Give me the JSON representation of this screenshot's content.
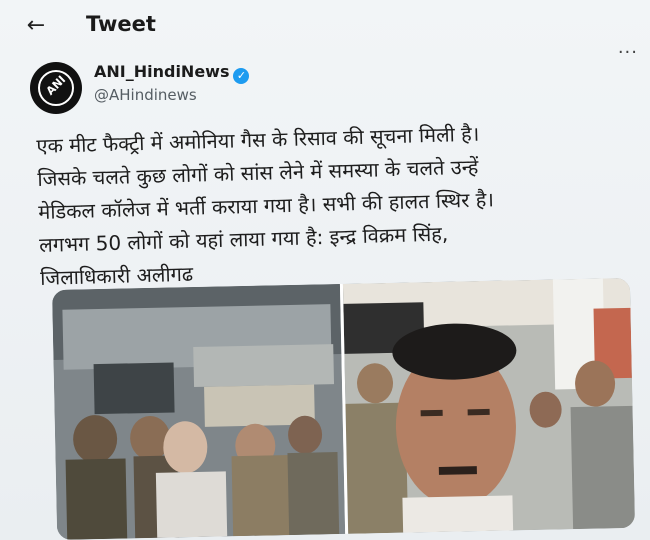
{
  "header": {
    "back_icon": "arrow-left-icon",
    "title": "Tweet"
  },
  "author": {
    "avatar_text": "ANI",
    "name": "ANI_HindiNews",
    "verified_icon": "verified-badge-icon",
    "handle": "@AHindinews",
    "more_icon": "more-options-icon"
  },
  "tweet": {
    "lines": [
      "एक मीट फैक्ट्री में अमोनिया गैस के रिसाव की सूचना मिली है।",
      "जिसके चलते कुछ लोगों को सांस लेने में समस्या के चलते उन्हें",
      "मेडिकल कॉलेज में भर्ती कराया गया है। सभी की हालत स्थिर है।",
      "लगभग 50 लोगों को यहां लाया गया है: इन्द्र विक्रम सिंह,",
      "जिलाधिकारी अलीगढ"
    ]
  },
  "media": {
    "photos": [
      "photo-police-hospital",
      "photo-official-selfie"
    ]
  }
}
